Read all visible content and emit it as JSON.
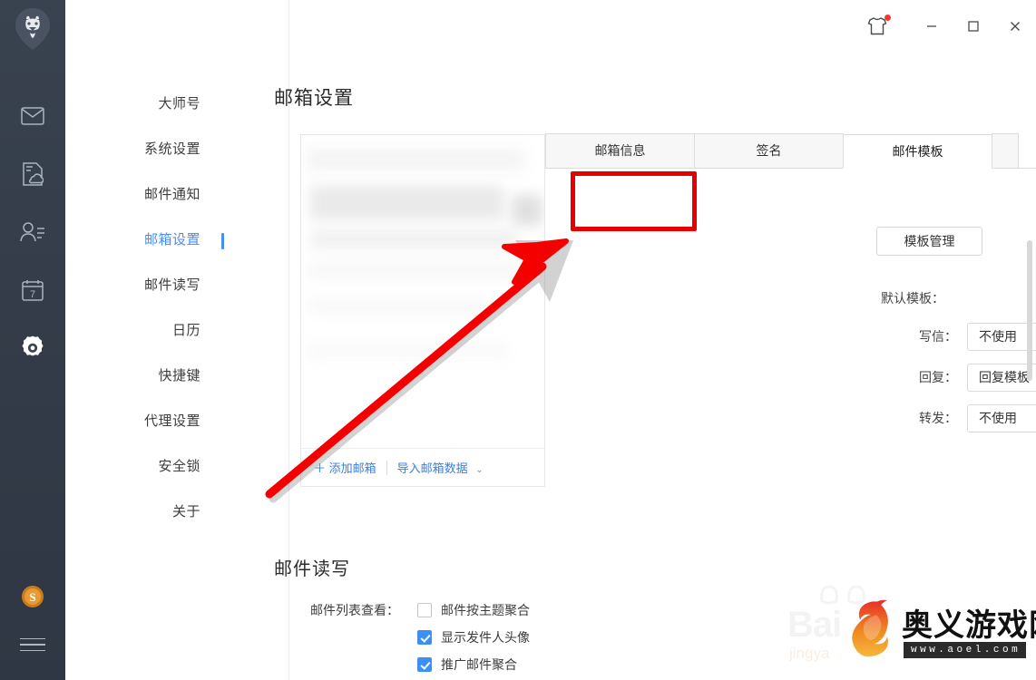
{
  "window": {
    "controls": [
      {
        "name": "skin-button",
        "icon": "tshirt-icon",
        "label": "",
        "badge": true
      },
      {
        "name": "minimize-button",
        "icon": "minimize-icon",
        "label": "—"
      },
      {
        "name": "maximize-button",
        "icon": "maximize-icon",
        "label": "□"
      },
      {
        "name": "close-button",
        "icon": "close-icon",
        "label": "✕"
      }
    ]
  },
  "rail": {
    "avatar_icon": "lion-avatar-icon",
    "items": [
      {
        "icon": "mail-icon",
        "active": false
      },
      {
        "icon": "cloud-doc-icon",
        "active": false
      },
      {
        "icon": "contacts-icon",
        "active": false
      },
      {
        "icon": "calendar-icon",
        "active": false,
        "day": "7"
      },
      {
        "icon": "gear-icon",
        "active": true
      }
    ],
    "coin_icon": "coin-icon",
    "menu_icon": "hamburger-menu-icon"
  },
  "nav": {
    "items": [
      {
        "label": "大师号",
        "active": false
      },
      {
        "label": "系统设置",
        "active": false
      },
      {
        "label": "邮件通知",
        "active": false
      },
      {
        "label": "邮箱设置",
        "active": true
      },
      {
        "label": "邮件读写",
        "active": false
      },
      {
        "label": "日历",
        "active": false
      },
      {
        "label": "快捷键",
        "active": false
      },
      {
        "label": "代理设置",
        "active": false
      },
      {
        "label": "安全锁",
        "active": false
      },
      {
        "label": "关于",
        "active": false
      }
    ],
    "accent_color": "#4a8cf7"
  },
  "main": {
    "page_title": "邮箱设置",
    "mailbox_panel": {
      "add_mailbox_label": "添加邮箱",
      "add_icon": "plus-icon",
      "import_label": "导入邮箱数据",
      "import_caret": "⌄"
    },
    "tabs": [
      {
        "label": "邮箱信息",
        "active": false
      },
      {
        "label": "签名",
        "active": false
      },
      {
        "label": "邮件模板",
        "active": true
      },
      {
        "label": "",
        "active": false
      }
    ],
    "template_tab": {
      "manage_button": "模板管理",
      "section_label": "默认模板：",
      "rows": [
        {
          "label": "写信：",
          "value": "不使用"
        },
        {
          "label": "回复：",
          "value": "回复模板"
        },
        {
          "label": "转发：",
          "value": "不使用"
        }
      ],
      "chevron": "⌄"
    }
  },
  "readwrite": {
    "title": "邮件读写",
    "caption": "邮件列表查看：",
    "options": [
      {
        "label": "邮件按主题聚合",
        "checked": false
      },
      {
        "label": "显示发件人头像",
        "checked": true
      },
      {
        "label": "推广邮件聚合",
        "checked": true
      }
    ],
    "checked_color": "#3d8ef5"
  },
  "annotations": {
    "highlight_color": "#e60000",
    "arrow_color": "#f40000",
    "target": "模板管理"
  },
  "watermark": {
    "baidu_text": "Bai",
    "baidu_sub": "jingya",
    "site_name": "奥义游戏网",
    "site_url": "www.aoel.com"
  }
}
